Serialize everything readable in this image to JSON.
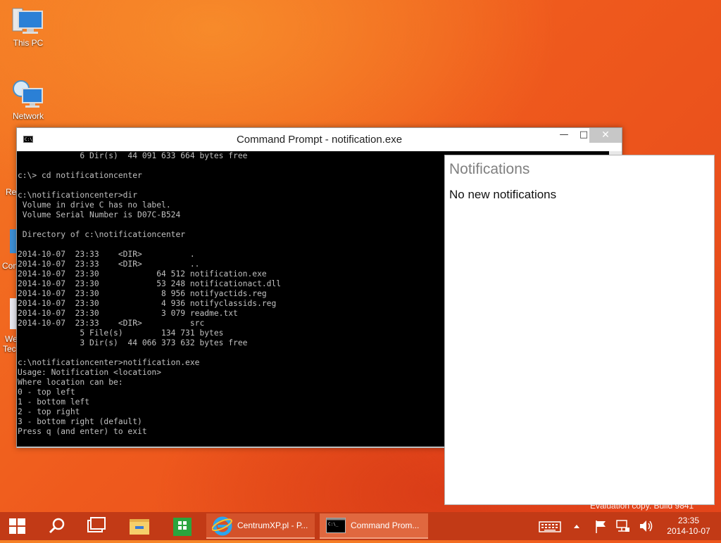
{
  "desktop": {
    "icons": [
      {
        "label": "This PC",
        "icon": "this-pc-icon"
      },
      {
        "label": "Network",
        "icon": "network-icon"
      }
    ],
    "partial_labels": [
      "Re",
      "Con",
      "We",
      "Tec"
    ]
  },
  "cmd_window": {
    "title": "Command Prompt - notification.exe",
    "icon_text": "C:\\",
    "lines": [
      "             6 Dir(s)  44 091 633 664 bytes free",
      "",
      "c:\\> cd notificationcenter",
      "",
      "c:\\notificationcenter>dir",
      " Volume in drive C has no label.",
      " Volume Serial Number is D07C-B524",
      "",
      " Directory of c:\\notificationcenter",
      "",
      "2014-10-07  23:33    <DIR>          .",
      "2014-10-07  23:33    <DIR>          ..",
      "2014-10-07  23:30            64 512 notification.exe",
      "2014-10-07  23:30            53 248 notificationact.dll",
      "2014-10-07  23:30             8 956 notifyactids.reg",
      "2014-10-07  23:30             4 936 notifyclassids.reg",
      "2014-10-07  23:30             3 079 readme.txt",
      "2014-10-07  23:33    <DIR>          src",
      "             5 File(s)        134 731 bytes",
      "             3 Dir(s)  44 066 373 632 bytes free",
      "",
      "c:\\notificationcenter>notification.exe",
      "Usage: Notification <location>",
      "Where location can be:",
      "0 - top left",
      "1 - bottom left",
      "2 - top right",
      "3 - bottom right (default)",
      "Press q (and enter) to exit"
    ]
  },
  "notifications": {
    "heading": "Notifications",
    "message": "No new notifications"
  },
  "watermark": "Evaluation copy. Build 9841",
  "taskbar": {
    "tasks": [
      {
        "label": "CentrumXP.pl - P...",
        "icon": "internet-explorer-icon"
      },
      {
        "label": "Command Prom...",
        "icon": "command-prompt-icon"
      }
    ],
    "clock": {
      "time": "23:35",
      "date": "2014-10-07"
    }
  },
  "colors": {
    "taskbar": "#c23a16",
    "console_bg": "#000000",
    "console_text": "#c0c0c0"
  }
}
